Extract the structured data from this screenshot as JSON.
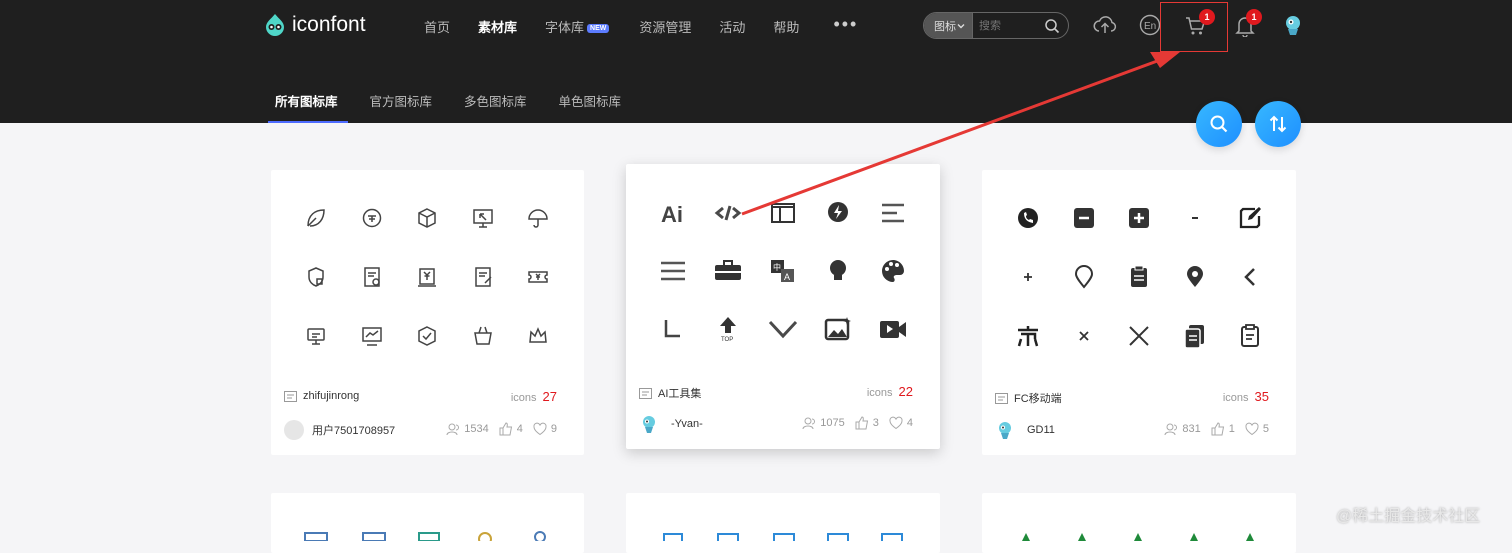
{
  "header": {
    "logo_text": "iconfont",
    "nav": [
      "首页",
      "素材库",
      "字体库",
      "资源管理",
      "活动",
      "帮助"
    ],
    "nav_active": "素材库",
    "new_badge": "NEW",
    "more": "•••",
    "search": {
      "category": "图标",
      "placeholder": "搜索"
    },
    "cart_count": "1",
    "notify_count": "1"
  },
  "subnav": {
    "tabs": [
      "所有图标库",
      "官方图标库",
      "多色图标库",
      "单色图标库"
    ],
    "active": "所有图标库"
  },
  "cards": [
    {
      "name": "zhifujinrong",
      "icons_label": "icons",
      "count": "27",
      "author": "用户7501708957",
      "users": "1534",
      "likes": "4",
      "favs": "9"
    },
    {
      "name": "AI工具集",
      "icons_label": "icons",
      "count": "22",
      "author": "-Yvan-",
      "users": "1075",
      "likes": "3",
      "favs": "4"
    },
    {
      "name": "FC移动端",
      "icons_label": "icons",
      "count": "35",
      "author": "GD11",
      "users": "831",
      "likes": "1",
      "favs": "5"
    }
  ],
  "card_icons": [
    [
      "leaf",
      "coin-circle",
      "cube",
      "screen-cursor",
      "umbrella",
      "shield-qr",
      "doc-check",
      "receipt-yen",
      "doc-edit",
      "ticket-yen",
      "monitor-stand",
      "chart-screen",
      "hexagon-check",
      "basket",
      "crown"
    ],
    [
      "ai",
      "code",
      "layout",
      "lightning-chat",
      "align-left",
      "menu",
      "briefcase",
      "translate",
      "bulb",
      "palette",
      "corner",
      "top-arrow",
      "chevron-down",
      "image-sparkle",
      "video"
    ],
    [
      "phone",
      "minus-square",
      "plus-square",
      "minus",
      "edit",
      "plus",
      "location-outline",
      "clipboard",
      "location",
      "chevron-left",
      "char",
      "close-small",
      "close",
      "copy",
      "clipboard-list"
    ]
  ],
  "colors": {
    "accent": "#4d6bff",
    "badge": "#e0191e",
    "fab": "#1e8fff"
  },
  "watermark": "@稀土掘金技术社区"
}
